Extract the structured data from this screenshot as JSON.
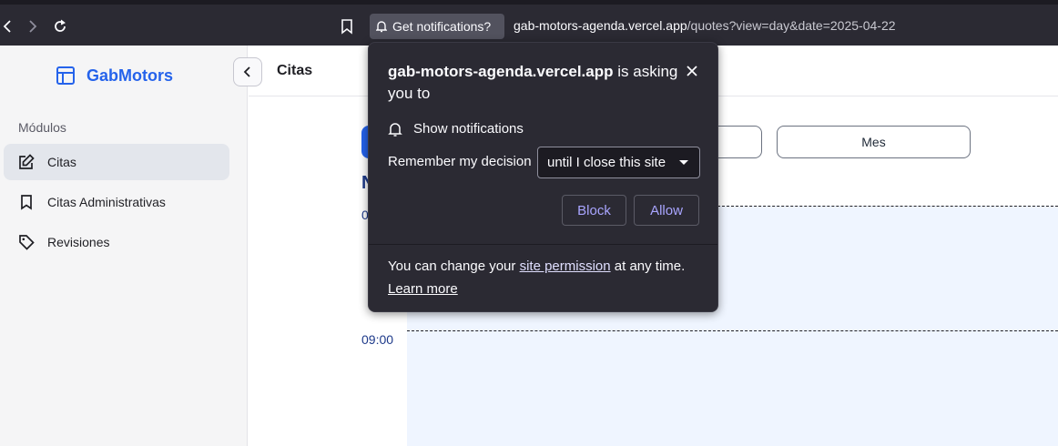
{
  "browser": {
    "notification_chip": "Get notifications?",
    "url_host": "gab-motors-agenda.vercel.app",
    "url_path": "/quotes?view=day&date=2025-04-22"
  },
  "sidebar": {
    "brand": "GabMotors",
    "section_label": "Módulos",
    "items": [
      {
        "label": "Citas",
        "icon": "edit-icon",
        "active": true
      },
      {
        "label": "Citas Administrativas",
        "icon": "bookmark-icon",
        "active": false
      },
      {
        "label": "Revisiones",
        "icon": "tag-icon",
        "active": false
      }
    ]
  },
  "header": {
    "title": "Citas"
  },
  "main": {
    "view_buttons": [
      "",
      "",
      "Mes"
    ],
    "date_heading_partial": "N",
    "time_labels": [
      "0",
      "09:00"
    ]
  },
  "popup": {
    "title_host": "gab-motors-agenda.vercel.app",
    "title_rest": " is asking you to",
    "permission": "Show notifications",
    "remember_label": "Remember my decision",
    "remember_value": "until I close this site",
    "block_label": "Block",
    "allow_label": "Allow",
    "footer_pre": "You can change your ",
    "footer_link": "site permission",
    "footer_post": " at any time.",
    "learn_more": "Learn more"
  },
  "colors": {
    "accent": "#2563eb",
    "popup_bg": "#2b2a33",
    "popup_button_text": "#a9a5ff"
  }
}
